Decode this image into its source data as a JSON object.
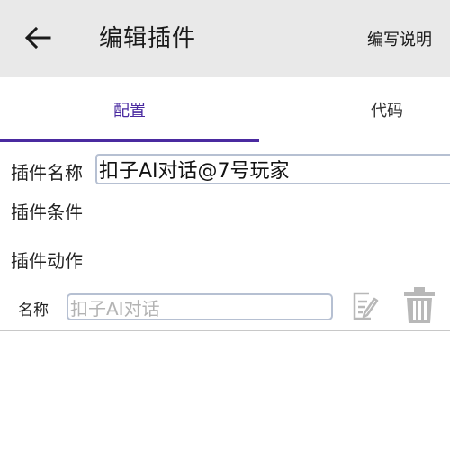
{
  "header": {
    "title": "编辑插件",
    "help_label": "编写说明",
    "background": "#e9e9e9"
  },
  "tabs": [
    {
      "label": "配置",
      "selected": true
    },
    {
      "label": "代码",
      "selected": false
    }
  ],
  "accent_color": "#4a2aa0",
  "form": {
    "plugin_name_label": "插件名称",
    "plugin_name_value": "扣子AI对话@7号玩家",
    "plugin_condition_label": "插件条件",
    "plugin_action_label": "插件动作",
    "action": {
      "name_label": "名称",
      "name_placeholder": "扣子AI对话"
    }
  },
  "icons": {
    "back": "arrow-left-icon",
    "edit": "edit-icon",
    "delete": "trash-icon"
  }
}
